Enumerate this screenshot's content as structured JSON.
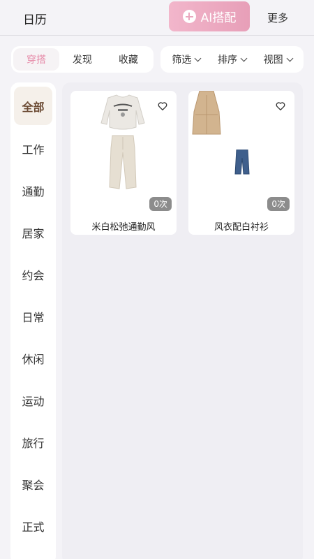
{
  "header": {
    "calendar_label": "日历",
    "ai_label": "AI搭配",
    "more_label": "更多"
  },
  "tabs": [
    {
      "label": "穿搭",
      "active": true
    },
    {
      "label": "发现"
    },
    {
      "label": "收藏"
    }
  ],
  "filters": [
    {
      "label": "筛选"
    },
    {
      "label": "排序"
    },
    {
      "label": "视图"
    }
  ],
  "sidebar": {
    "items": [
      {
        "label": "全部",
        "active": true
      },
      {
        "label": "工作"
      },
      {
        "label": "通勤"
      },
      {
        "label": "居家"
      },
      {
        "label": "约会"
      },
      {
        "label": "日常"
      },
      {
        "label": "休闲"
      },
      {
        "label": "运动"
      },
      {
        "label": "旅行"
      },
      {
        "label": "聚会"
      },
      {
        "label": "正式"
      }
    ]
  },
  "outfits": [
    {
      "title": "米白松弛通勤风",
      "count": "0次",
      "icon": "heart-outline-icon"
    },
    {
      "title": "风衣配白衬衫",
      "count": "0次",
      "icon": "heart-outline-icon"
    }
  ],
  "colors": {
    "accent": "#e68aa8",
    "ai_button": "#eaa7be",
    "sidebar_active_bg": "#f5f0ea",
    "sidebar_active_text": "#6b4a33"
  }
}
